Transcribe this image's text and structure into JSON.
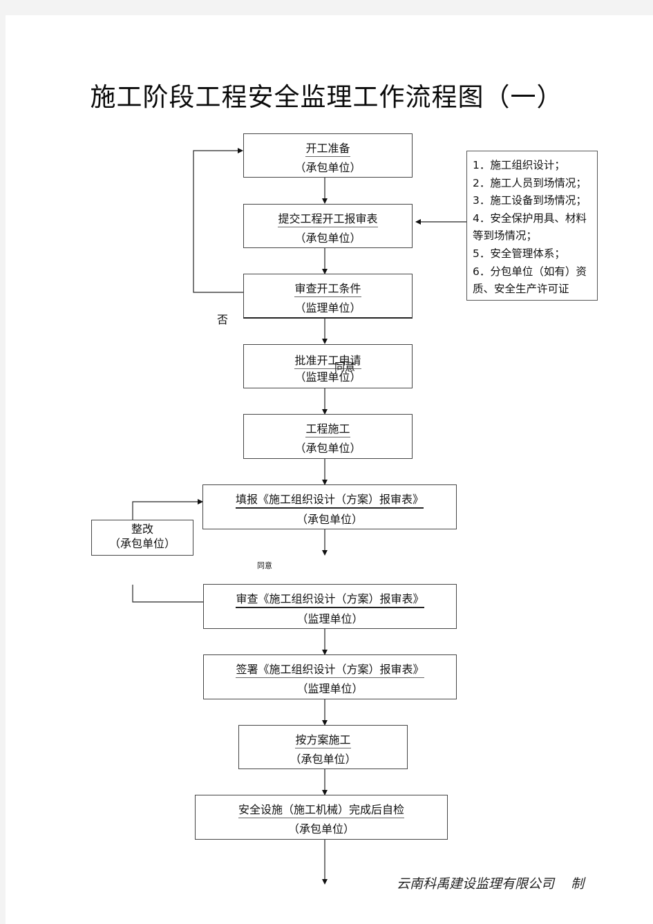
{
  "title": "施工阶段工程安全监理工作流程图（一）",
  "steps": [
    {
      "name": "开工准备",
      "party": "（承包单位）"
    },
    {
      "name": "提交工程开工报审表",
      "party": "（承包单位）"
    },
    {
      "name": "审查开工条件",
      "party": "（监理单位）"
    },
    {
      "name": "批准开工申请",
      "party": "（监理单位）"
    },
    {
      "name": "工程施工",
      "party": "（承包单位）"
    },
    {
      "name": "填报《施工组织设计（方案）报审表》",
      "party": "（承包单位）"
    },
    {
      "name": "审查《施工组织设计（方案）报审表》",
      "party": "（监理单位）"
    },
    {
      "name": "签署《施工组织设计（方案）报审表》",
      "party": "（监理单位）"
    },
    {
      "name": "按方案施工",
      "party": "（承包单位）"
    },
    {
      "name": "安全设施（施工机械）完成后自检",
      "party": "（承包单位）"
    }
  ],
  "rework": {
    "name": "整改",
    "party": "（承包单位）"
  },
  "requirements": [
    "1．施工组织设计；",
    "2．施工人员到场情况；",
    "3．施工设备到场情况；",
    "4．安全保护用具、材料等到场情况；",
    "5．安全管理体系；",
    "6．分包单位（如有）资质、安全生产许可证"
  ],
  "labels": {
    "reject": "否",
    "approve_1": "同意",
    "approve_2": "同意"
  },
  "footer": "云南科禹建设监理有限公司    制"
}
